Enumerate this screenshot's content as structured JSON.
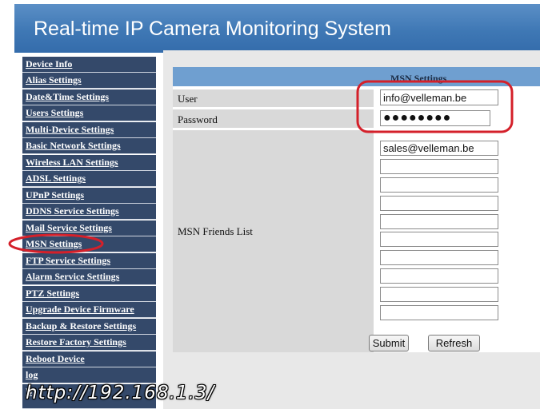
{
  "header": {
    "title": "Real-time IP Camera Monitoring System"
  },
  "sidebar": {
    "items": [
      {
        "label": "Device Info"
      },
      {
        "label": "Alias Settings"
      },
      {
        "label": "Date&Time Settings"
      },
      {
        "label": "Users Settings"
      },
      {
        "label": "Multi-Device Settings"
      },
      {
        "label": "Basic Network Settings"
      },
      {
        "label": "Wireless LAN Settings"
      },
      {
        "label": "ADSL Settings"
      },
      {
        "label": "UPnP Settings"
      },
      {
        "label": "DDNS Service Settings"
      },
      {
        "label": "Mail Service Settings"
      },
      {
        "label": "MSN Settings",
        "selected": true
      },
      {
        "label": "FTP Service Settings"
      },
      {
        "label": "Alarm Service Settings"
      },
      {
        "label": "PTZ Settings"
      },
      {
        "label": "Upgrade Device Firmware"
      },
      {
        "label": "Backup & Restore Settings"
      },
      {
        "label": "Restore Factory Settings"
      },
      {
        "label": "Reboot Device"
      },
      {
        "label": "log"
      },
      {
        "label": "B"
      }
    ]
  },
  "msn": {
    "title": "MSN Settings",
    "user_label": "User",
    "user_value": "info@velleman.be",
    "password_label": "Password",
    "password_value": "●●●●●●●●",
    "friends_label": "MSN Friends List",
    "friends": [
      "sales@velleman.be",
      "",
      "",
      "",
      "",
      "",
      "",
      "",
      "",
      ""
    ]
  },
  "buttons": {
    "submit": "Submit",
    "refresh": "Refresh"
  },
  "annotation": {
    "url": "http://192.168.1.3/",
    "highlight_color": "#d4202a"
  },
  "colors": {
    "header_blue": "#3f78b5",
    "sidebar_navy": "#34496a",
    "panel_header_blue": "#6f9fd0",
    "label_gray": "#d9d9d9"
  }
}
